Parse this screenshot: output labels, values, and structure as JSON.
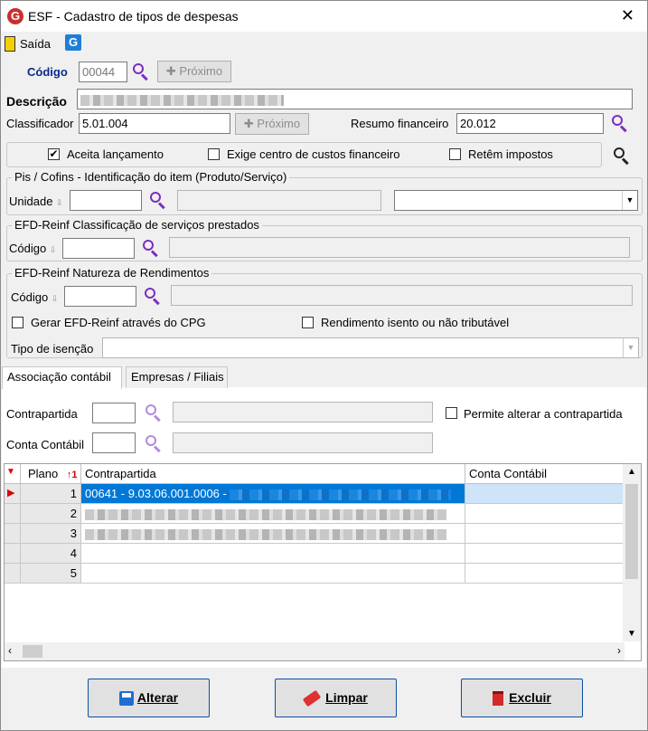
{
  "window": {
    "title": "ESF - Cadastro de tipos de despesas",
    "close_glyph": "✕"
  },
  "toolbar": {
    "exit_label": "Saída"
  },
  "codigo": {
    "label": "Código",
    "value": "00044",
    "next_label": "Próximo"
  },
  "descricao": {
    "label": "Descrição"
  },
  "classificador": {
    "label": "Classificador",
    "value": "5.01.004",
    "next_label": "Próximo"
  },
  "resumo": {
    "label": "Resumo financeiro",
    "value": "20.012"
  },
  "options": {
    "aceita": {
      "label": "Aceita lançamento",
      "checked": true
    },
    "exige": {
      "label": "Exige centro de custos financeiro",
      "checked": false
    },
    "retem": {
      "label": "Retêm impostos",
      "checked": false
    }
  },
  "pis_group": {
    "title": "Pis / Cofins - Identificação do item (Produto/Serviço)",
    "unidade_label": "Unidade"
  },
  "efd_class_group": {
    "title": "EFD-Reinf Classificação de serviços prestados",
    "codigo_label": "Código"
  },
  "efd_nat_group": {
    "title": "EFD-Reinf Natureza de Rendimentos",
    "codigo_label": "Código",
    "gerar_label": "Gerar EFD-Reinf através do CPG",
    "isento_label": "Rendimento isento ou não tributável",
    "isencao_label": "Tipo de isenção"
  },
  "tabs": [
    {
      "label": "Associação contábil"
    },
    {
      "label": "Empresas / Filiais"
    }
  ],
  "assoc": {
    "contrapartida_label": "Contrapartida",
    "conta_label": "Conta Contábil",
    "permite_label": "Permite alterar a contrapartida"
  },
  "grid": {
    "headers": {
      "plano": "Plano",
      "plano_sort": "1",
      "contrapartida": "Contrapartida",
      "conta": "Conta Contábil"
    },
    "rows": [
      {
        "plano": "1",
        "contrapartida": "00641 - 9.03.06.001.0006 -"
      },
      {
        "plano": "2",
        "contrapartida": ""
      },
      {
        "plano": "3",
        "contrapartida": ""
      },
      {
        "plano": "4",
        "contrapartida": ""
      },
      {
        "plano": "5",
        "contrapartida": ""
      }
    ],
    "selection_color": "#0078d7"
  },
  "buttons": {
    "alterar": "Alterar",
    "limpar": "Limpar",
    "excluir": "Excluir"
  },
  "colors": {
    "accent": "#0a4fa3",
    "search_icon": "#7b2fbe",
    "brand": "#c9302c"
  }
}
